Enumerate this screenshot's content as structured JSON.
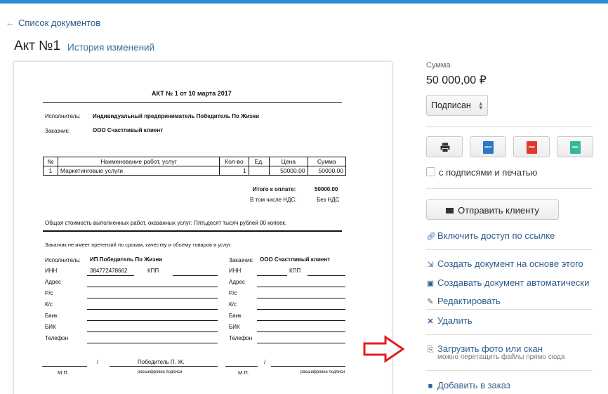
{
  "nav": {
    "back_label": "Список документов"
  },
  "header": {
    "title": "Акт №1",
    "history_link": "История изменений"
  },
  "document": {
    "title": "АКТ № 1 от 10 марта 2017",
    "executor_label": "Исполнитель:",
    "executor_value": "Индивидуальный предприниматель Победитель По Жизни",
    "customer_label": "Заказчик:",
    "customer_value": "ООО Счастливый клиент",
    "table": {
      "headers": [
        "№",
        "Наименование работ, услуг",
        "Кол-во",
        "Ед.",
        "Цена",
        "Сумма"
      ],
      "rows": [
        [
          "1",
          "Маркетинговые услуги",
          "1",
          "",
          "50000.00",
          "50000.00"
        ]
      ]
    },
    "total_label": "Итого к оплате:",
    "total_value": "50000.00",
    "vat_label": "В том числе НДС:",
    "vat_value": "Без НДС",
    "total_text": "Общая стоимость выполненных работ, оказанных услуг: Пятьдесят тысяч рублей 00 копеек.",
    "no_claims": "Заказчик не имеет претензий по срокам, качеству и объему товаров и услуг.",
    "left_party": {
      "label": "Исполнитель:",
      "name": "ИП Победитель По Жизни",
      "inn_label": "ИНН",
      "inn_value": "384772478662",
      "kpp_label": "КПП",
      "address_label": "Адрес",
      "rs_label": "Р/с",
      "ks_label": "К/с",
      "bank_label": "Банк",
      "bik_label": "БИК",
      "phone_label": "Телефон"
    },
    "right_party": {
      "label": "Заказчик:",
      "name": "ООО Счастливый клиент",
      "inn_label": "ИНН",
      "kpp_label": "КПП",
      "address_label": "Адрес",
      "rs_label": "Р/с",
      "ks_label": "К/с",
      "bank_label": "Банк",
      "bik_label": "БИК",
      "phone_label": "Телефон"
    },
    "sign": {
      "slash": "/",
      "left_name": "Победитель П. Ж.",
      "mp": "М.П.",
      "decode": "расшифровка подписи"
    }
  },
  "panel": {
    "sum_label": "Сумма",
    "sum_value": "50 000,00 ₽",
    "status_value": "Подписан",
    "formats": [
      {
        "name": "print",
        "label": ""
      },
      {
        "name": "doc",
        "label": "DOC",
        "color": "#2b79c2"
      },
      {
        "name": "pdf",
        "label": "PDF",
        "color": "#e03a2f"
      },
      {
        "name": "xml",
        "label": "XML",
        "color": "#34b89a"
      }
    ],
    "with_signatures_label": "с подписями и печатью",
    "send_button": "Отправить клиенту",
    "actions": {
      "link_access": "Включить доступ по ссылке",
      "create_based": "Создать документ на основе этого",
      "create_auto": "Создавать документ автоматически",
      "edit": "Редактировать",
      "delete": "Удалить",
      "upload": "Загрузить фото или скан",
      "upload_hint": "можно перетащить файлы прямо сюда",
      "add_to_order": "Добавить в заказ"
    },
    "accent_color": "#2f5f8e",
    "highlight_arrow_color": "#e02020"
  }
}
